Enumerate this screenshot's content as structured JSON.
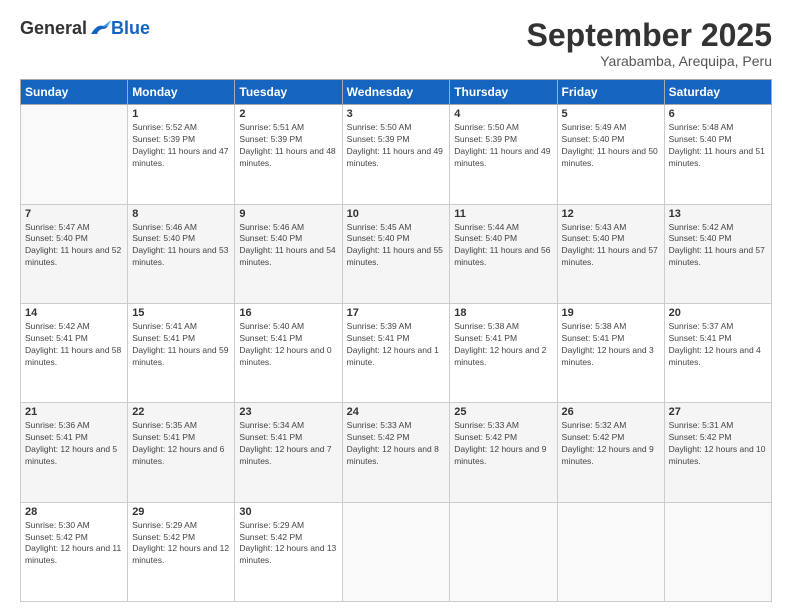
{
  "header": {
    "logo": {
      "general": "General",
      "blue": "Blue"
    },
    "title": "September 2025",
    "location": "Yarabamba, Arequipa, Peru"
  },
  "weekdays": [
    "Sunday",
    "Monday",
    "Tuesday",
    "Wednesday",
    "Thursday",
    "Friday",
    "Saturday"
  ],
  "weeks": [
    [
      {
        "day": "",
        "sunrise": "",
        "sunset": "",
        "daylight": ""
      },
      {
        "day": "1",
        "sunrise": "Sunrise: 5:52 AM",
        "sunset": "Sunset: 5:39 PM",
        "daylight": "Daylight: 11 hours and 47 minutes."
      },
      {
        "day": "2",
        "sunrise": "Sunrise: 5:51 AM",
        "sunset": "Sunset: 5:39 PM",
        "daylight": "Daylight: 11 hours and 48 minutes."
      },
      {
        "day": "3",
        "sunrise": "Sunrise: 5:50 AM",
        "sunset": "Sunset: 5:39 PM",
        "daylight": "Daylight: 11 hours and 49 minutes."
      },
      {
        "day": "4",
        "sunrise": "Sunrise: 5:50 AM",
        "sunset": "Sunset: 5:39 PM",
        "daylight": "Daylight: 11 hours and 49 minutes."
      },
      {
        "day": "5",
        "sunrise": "Sunrise: 5:49 AM",
        "sunset": "Sunset: 5:40 PM",
        "daylight": "Daylight: 11 hours and 50 minutes."
      },
      {
        "day": "6",
        "sunrise": "Sunrise: 5:48 AM",
        "sunset": "Sunset: 5:40 PM",
        "daylight": "Daylight: 11 hours and 51 minutes."
      }
    ],
    [
      {
        "day": "7",
        "sunrise": "Sunrise: 5:47 AM",
        "sunset": "Sunset: 5:40 PM",
        "daylight": "Daylight: 11 hours and 52 minutes."
      },
      {
        "day": "8",
        "sunrise": "Sunrise: 5:46 AM",
        "sunset": "Sunset: 5:40 PM",
        "daylight": "Daylight: 11 hours and 53 minutes."
      },
      {
        "day": "9",
        "sunrise": "Sunrise: 5:46 AM",
        "sunset": "Sunset: 5:40 PM",
        "daylight": "Daylight: 11 hours and 54 minutes."
      },
      {
        "day": "10",
        "sunrise": "Sunrise: 5:45 AM",
        "sunset": "Sunset: 5:40 PM",
        "daylight": "Daylight: 11 hours and 55 minutes."
      },
      {
        "day": "11",
        "sunrise": "Sunrise: 5:44 AM",
        "sunset": "Sunset: 5:40 PM",
        "daylight": "Daylight: 11 hours and 56 minutes."
      },
      {
        "day": "12",
        "sunrise": "Sunrise: 5:43 AM",
        "sunset": "Sunset: 5:40 PM",
        "daylight": "Daylight: 11 hours and 57 minutes."
      },
      {
        "day": "13",
        "sunrise": "Sunrise: 5:42 AM",
        "sunset": "Sunset: 5:40 PM",
        "daylight": "Daylight: 11 hours and 57 minutes."
      }
    ],
    [
      {
        "day": "14",
        "sunrise": "Sunrise: 5:42 AM",
        "sunset": "Sunset: 5:41 PM",
        "daylight": "Daylight: 11 hours and 58 minutes."
      },
      {
        "day": "15",
        "sunrise": "Sunrise: 5:41 AM",
        "sunset": "Sunset: 5:41 PM",
        "daylight": "Daylight: 11 hours and 59 minutes."
      },
      {
        "day": "16",
        "sunrise": "Sunrise: 5:40 AM",
        "sunset": "Sunset: 5:41 PM",
        "daylight": "Daylight: 12 hours and 0 minutes."
      },
      {
        "day": "17",
        "sunrise": "Sunrise: 5:39 AM",
        "sunset": "Sunset: 5:41 PM",
        "daylight": "Daylight: 12 hours and 1 minute."
      },
      {
        "day": "18",
        "sunrise": "Sunrise: 5:38 AM",
        "sunset": "Sunset: 5:41 PM",
        "daylight": "Daylight: 12 hours and 2 minutes."
      },
      {
        "day": "19",
        "sunrise": "Sunrise: 5:38 AM",
        "sunset": "Sunset: 5:41 PM",
        "daylight": "Daylight: 12 hours and 3 minutes."
      },
      {
        "day": "20",
        "sunrise": "Sunrise: 5:37 AM",
        "sunset": "Sunset: 5:41 PM",
        "daylight": "Daylight: 12 hours and 4 minutes."
      }
    ],
    [
      {
        "day": "21",
        "sunrise": "Sunrise: 5:36 AM",
        "sunset": "Sunset: 5:41 PM",
        "daylight": "Daylight: 12 hours and 5 minutes."
      },
      {
        "day": "22",
        "sunrise": "Sunrise: 5:35 AM",
        "sunset": "Sunset: 5:41 PM",
        "daylight": "Daylight: 12 hours and 6 minutes."
      },
      {
        "day": "23",
        "sunrise": "Sunrise: 5:34 AM",
        "sunset": "Sunset: 5:41 PM",
        "daylight": "Daylight: 12 hours and 7 minutes."
      },
      {
        "day": "24",
        "sunrise": "Sunrise: 5:33 AM",
        "sunset": "Sunset: 5:42 PM",
        "daylight": "Daylight: 12 hours and 8 minutes."
      },
      {
        "day": "25",
        "sunrise": "Sunrise: 5:33 AM",
        "sunset": "Sunset: 5:42 PM",
        "daylight": "Daylight: 12 hours and 9 minutes."
      },
      {
        "day": "26",
        "sunrise": "Sunrise: 5:32 AM",
        "sunset": "Sunset: 5:42 PM",
        "daylight": "Daylight: 12 hours and 9 minutes."
      },
      {
        "day": "27",
        "sunrise": "Sunrise: 5:31 AM",
        "sunset": "Sunset: 5:42 PM",
        "daylight": "Daylight: 12 hours and 10 minutes."
      }
    ],
    [
      {
        "day": "28",
        "sunrise": "Sunrise: 5:30 AM",
        "sunset": "Sunset: 5:42 PM",
        "daylight": "Daylight: 12 hours and 11 minutes."
      },
      {
        "day": "29",
        "sunrise": "Sunrise: 5:29 AM",
        "sunset": "Sunset: 5:42 PM",
        "daylight": "Daylight: 12 hours and 12 minutes."
      },
      {
        "day": "30",
        "sunrise": "Sunrise: 5:29 AM",
        "sunset": "Sunset: 5:42 PM",
        "daylight": "Daylight: 12 hours and 13 minutes."
      },
      {
        "day": "",
        "sunrise": "",
        "sunset": "",
        "daylight": ""
      },
      {
        "day": "",
        "sunrise": "",
        "sunset": "",
        "daylight": ""
      },
      {
        "day": "",
        "sunrise": "",
        "sunset": "",
        "daylight": ""
      },
      {
        "day": "",
        "sunrise": "",
        "sunset": "",
        "daylight": ""
      }
    ]
  ]
}
